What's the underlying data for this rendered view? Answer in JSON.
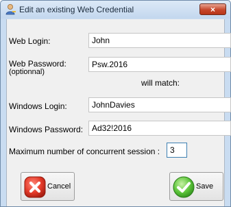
{
  "window": {
    "title": "Edit an existing Web Credential",
    "close_glyph": "×"
  },
  "form": {
    "web_login_label": "Web Login:",
    "web_login_value": "John",
    "web_password_label": "Web Password:",
    "web_password_note": "(optionnal)",
    "web_password_value": "Psw.2016",
    "will_match_text": "will match:",
    "windows_login_label": "Windows Login:",
    "windows_login_value": "JohnDavies",
    "windows_password_label": "Windows Password:",
    "windows_password_value": "Ad32!2016",
    "max_sessions_label": "Maximum number of concurrent session :",
    "max_sessions_value": "3"
  },
  "buttons": {
    "cancel_label": "Cancel",
    "save_label": "Save"
  },
  "icons": {
    "title": "user-key-icon",
    "cancel": "cancel-x-icon",
    "save": "check-icon"
  },
  "colors": {
    "cancel_red": "#e53b2a",
    "save_green": "#5cc43a",
    "close_red": "#c7472c"
  }
}
